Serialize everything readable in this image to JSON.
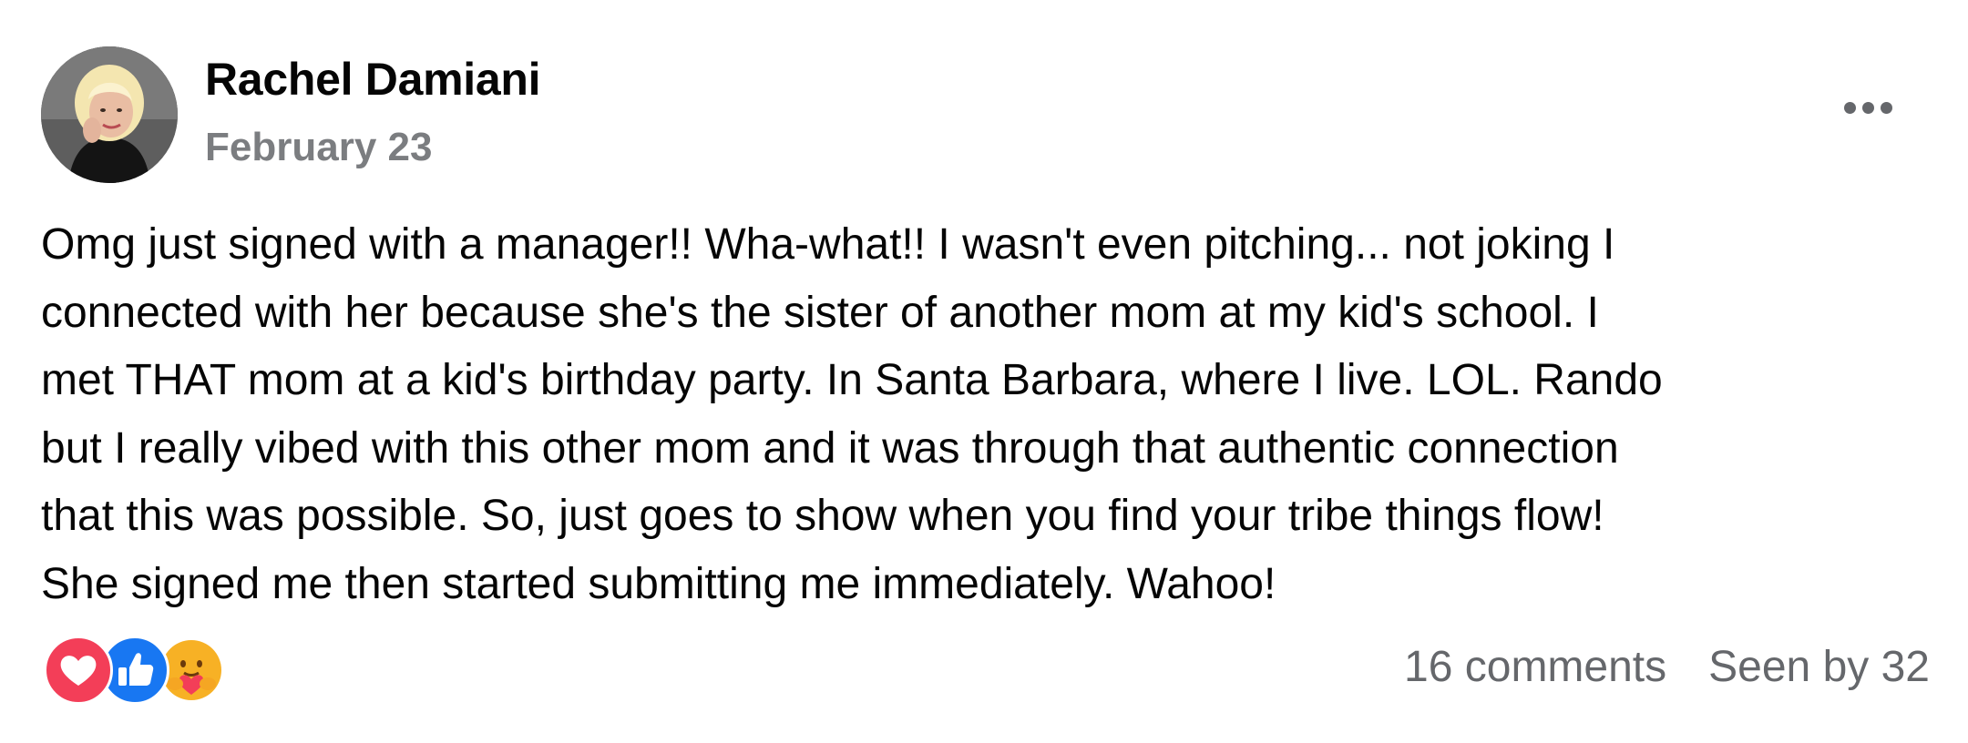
{
  "post": {
    "author": "Rachel Damiani",
    "date": "February 23",
    "body": "Omg just signed with a manager!! Wha-what!! I wasn't even pitching... not joking I\nconnected with her because she's the sister of another mom at my kid's school. I\nmet THAT mom at a kid's birthday party. In Santa Barbara, where I live. LOL. Rando\nbut I really vibed with this other mom and it was through that authentic connection\nthat this was possible. So, just goes to show when you find your tribe things flow!\nShe signed me then started submitting me immediately. Wahoo!"
  },
  "footer": {
    "comments": "16 comments",
    "seen_by": "Seen by 32"
  },
  "reactions": [
    "love-icon",
    "like-icon",
    "care-icon"
  ],
  "icons": {
    "more": "more-options-icon"
  },
  "colors": {
    "love": "#f33e58",
    "like": "#1877f2",
    "care": "#f7b125",
    "muted_text": "#65676b"
  }
}
